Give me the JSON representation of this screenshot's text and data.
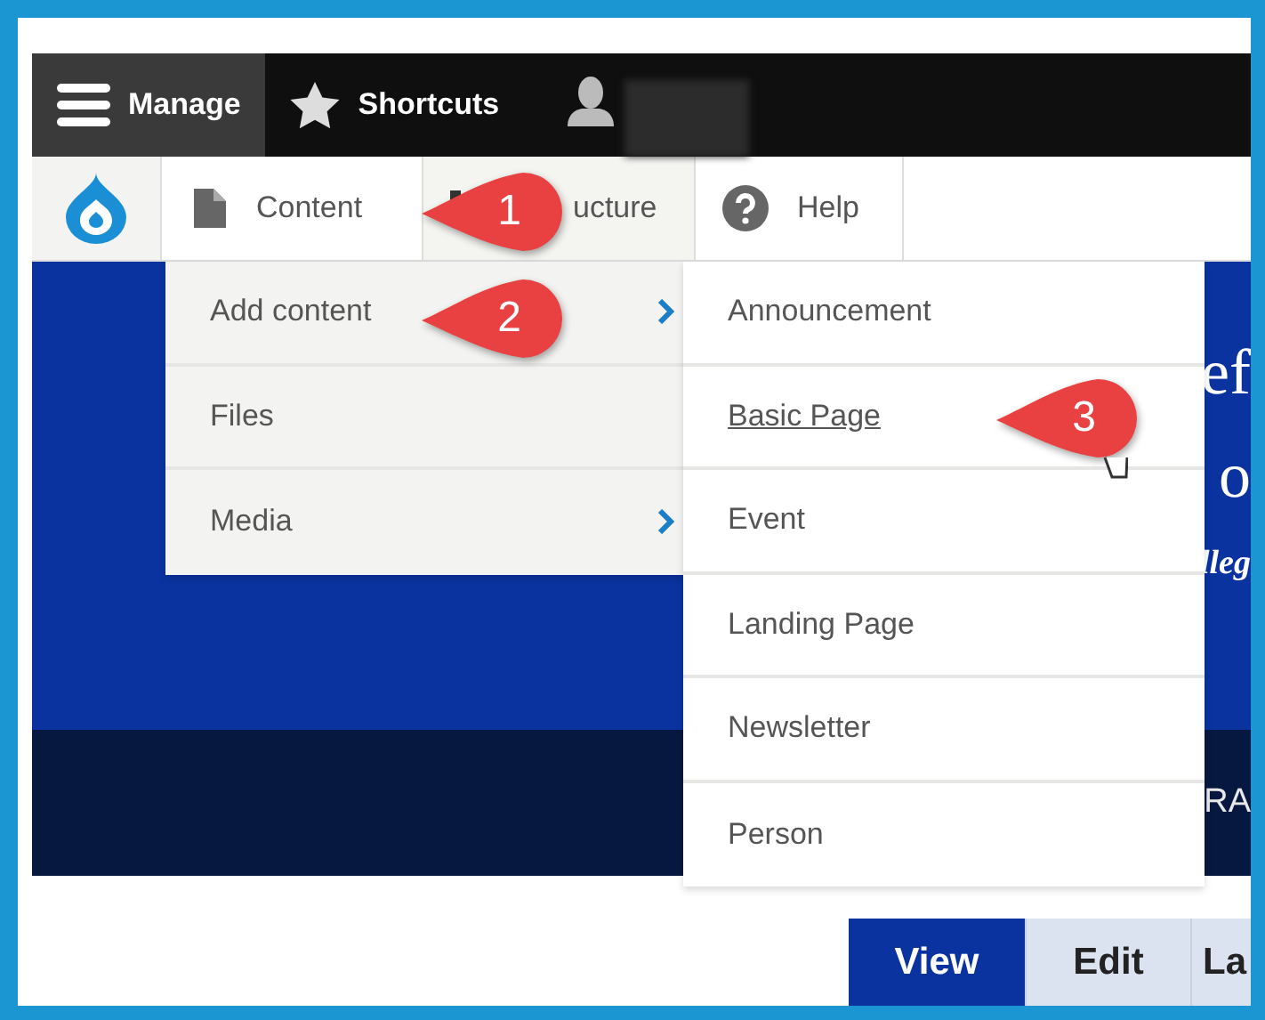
{
  "toolbar": {
    "items": [
      {
        "kind": "menu",
        "label": "Manage",
        "selected": true
      },
      {
        "kind": "star",
        "label": "Shortcuts",
        "selected": false
      },
      {
        "kind": "user",
        "selected": false
      }
    ]
  },
  "admin_menu": {
    "items": [
      {
        "kind": "content",
        "label": "Content",
        "hovered": false
      },
      {
        "kind": "structure",
        "label": "ucture",
        "hovered": true
      },
      {
        "kind": "help",
        "label": "Help",
        "hovered": false
      }
    ]
  },
  "content_menu": {
    "items": [
      {
        "label": "Add content",
        "submenu": true
      },
      {
        "label": "Files",
        "submenu": false
      },
      {
        "label": "Media",
        "submenu": true
      }
    ]
  },
  "add_content_menu": {
    "items": [
      {
        "label": "Announcement",
        "hovered": false
      },
      {
        "label": "Basic Page",
        "hovered": true
      },
      {
        "label": "Event",
        "hovered": false
      },
      {
        "label": "Landing Page",
        "hovered": false
      },
      {
        "label": "Newsletter",
        "hovered": false
      },
      {
        "label": "Person",
        "hovered": false
      }
    ]
  },
  "hero": {
    "lines": [
      "ef",
      "o",
      "lleg"
    ],
    "band_text": "RA"
  },
  "page_tabs": [
    {
      "label": "View",
      "selected": true
    },
    {
      "label": "Edit",
      "selected": false
    },
    {
      "label": "La",
      "selected": false
    }
  ],
  "callouts": [
    {
      "number": "1"
    },
    {
      "number": "2"
    },
    {
      "number": "3"
    }
  ]
}
